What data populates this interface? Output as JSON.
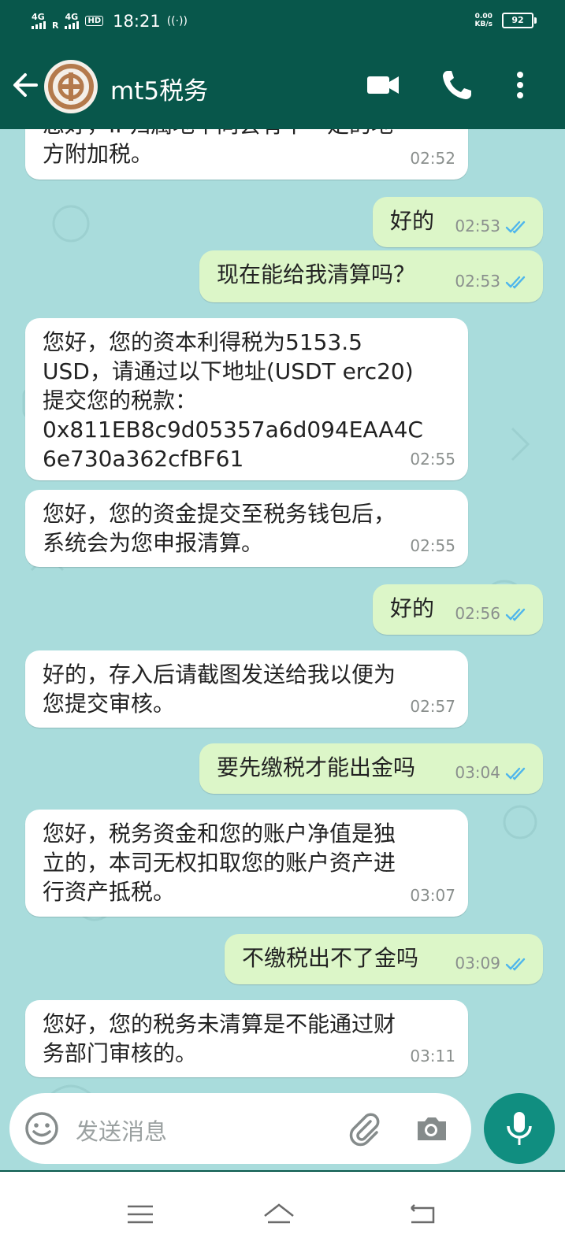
{
  "status_bar": {
    "net1": "4G",
    "net1_sub": "R",
    "net2": "4G",
    "hd": "HD",
    "time": "18:21",
    "speed_value": "0.00",
    "speed_unit": "KB/s",
    "battery": "92"
  },
  "header": {
    "contact_name": "mt5税务"
  },
  "messages": [
    {
      "dir": "in",
      "text": "您好，IP归属地不同会有不一定的地\n方附加税。",
      "time": "02:52",
      "read": false
    },
    {
      "dir": "out",
      "text": "好的",
      "time": "02:53",
      "read": true
    },
    {
      "dir": "out",
      "text": "现在能给我清算吗？",
      "time": "02:53",
      "read": true
    },
    {
      "dir": "in",
      "text": "您好，您的资本利得税为5153.5\nUSD，请通过以下地址(USDT erc20)\n提交您的税款：\n0x811EB8c9d05357a6d094EAA4C\n6e730a362cfBF61",
      "time": "02:55",
      "read": false
    },
    {
      "dir": "in",
      "text": "您好，您的资金提交至税务钱包后，\n系统会为您申报清算。",
      "time": "02:55",
      "read": false
    },
    {
      "dir": "out",
      "text": "好的",
      "time": "02:56",
      "read": true
    },
    {
      "dir": "in",
      "text": "好的，存入后请截图发送给我以便为\n您提交审核。",
      "time": "02:57",
      "read": false
    },
    {
      "dir": "out",
      "text": "要先缴税才能出金吗",
      "time": "03:04",
      "read": true
    },
    {
      "dir": "in",
      "text": "您好，税务资金和您的账户净值是独\n立的，本司无权扣取您的账户资产进\n行资产抵税。",
      "time": "03:07",
      "read": false
    },
    {
      "dir": "out",
      "text": "不缴税出不了金吗",
      "time": "03:09",
      "read": true
    },
    {
      "dir": "in",
      "text": "您好，您的税务未清算是不能通过财\n务部门审核的。",
      "time": "03:11",
      "read": false
    }
  ],
  "composer": {
    "placeholder": "发送消息"
  },
  "colors": {
    "header_bg": "#08574b",
    "chat_bg": "#a9dcdc",
    "outgoing_bubble": "#dcf6c8",
    "incoming_bubble": "#ffffff",
    "read_tick": "#4fb6ec",
    "mic_button": "#108e80"
  },
  "icons": {
    "back": "arrow-left-icon",
    "video": "video-camera-icon",
    "call": "phone-icon",
    "menu": "more-vertical-icon",
    "emoji": "emoji-icon",
    "attach": "paperclip-icon",
    "camera": "camera-icon",
    "mic": "microphone-icon"
  }
}
